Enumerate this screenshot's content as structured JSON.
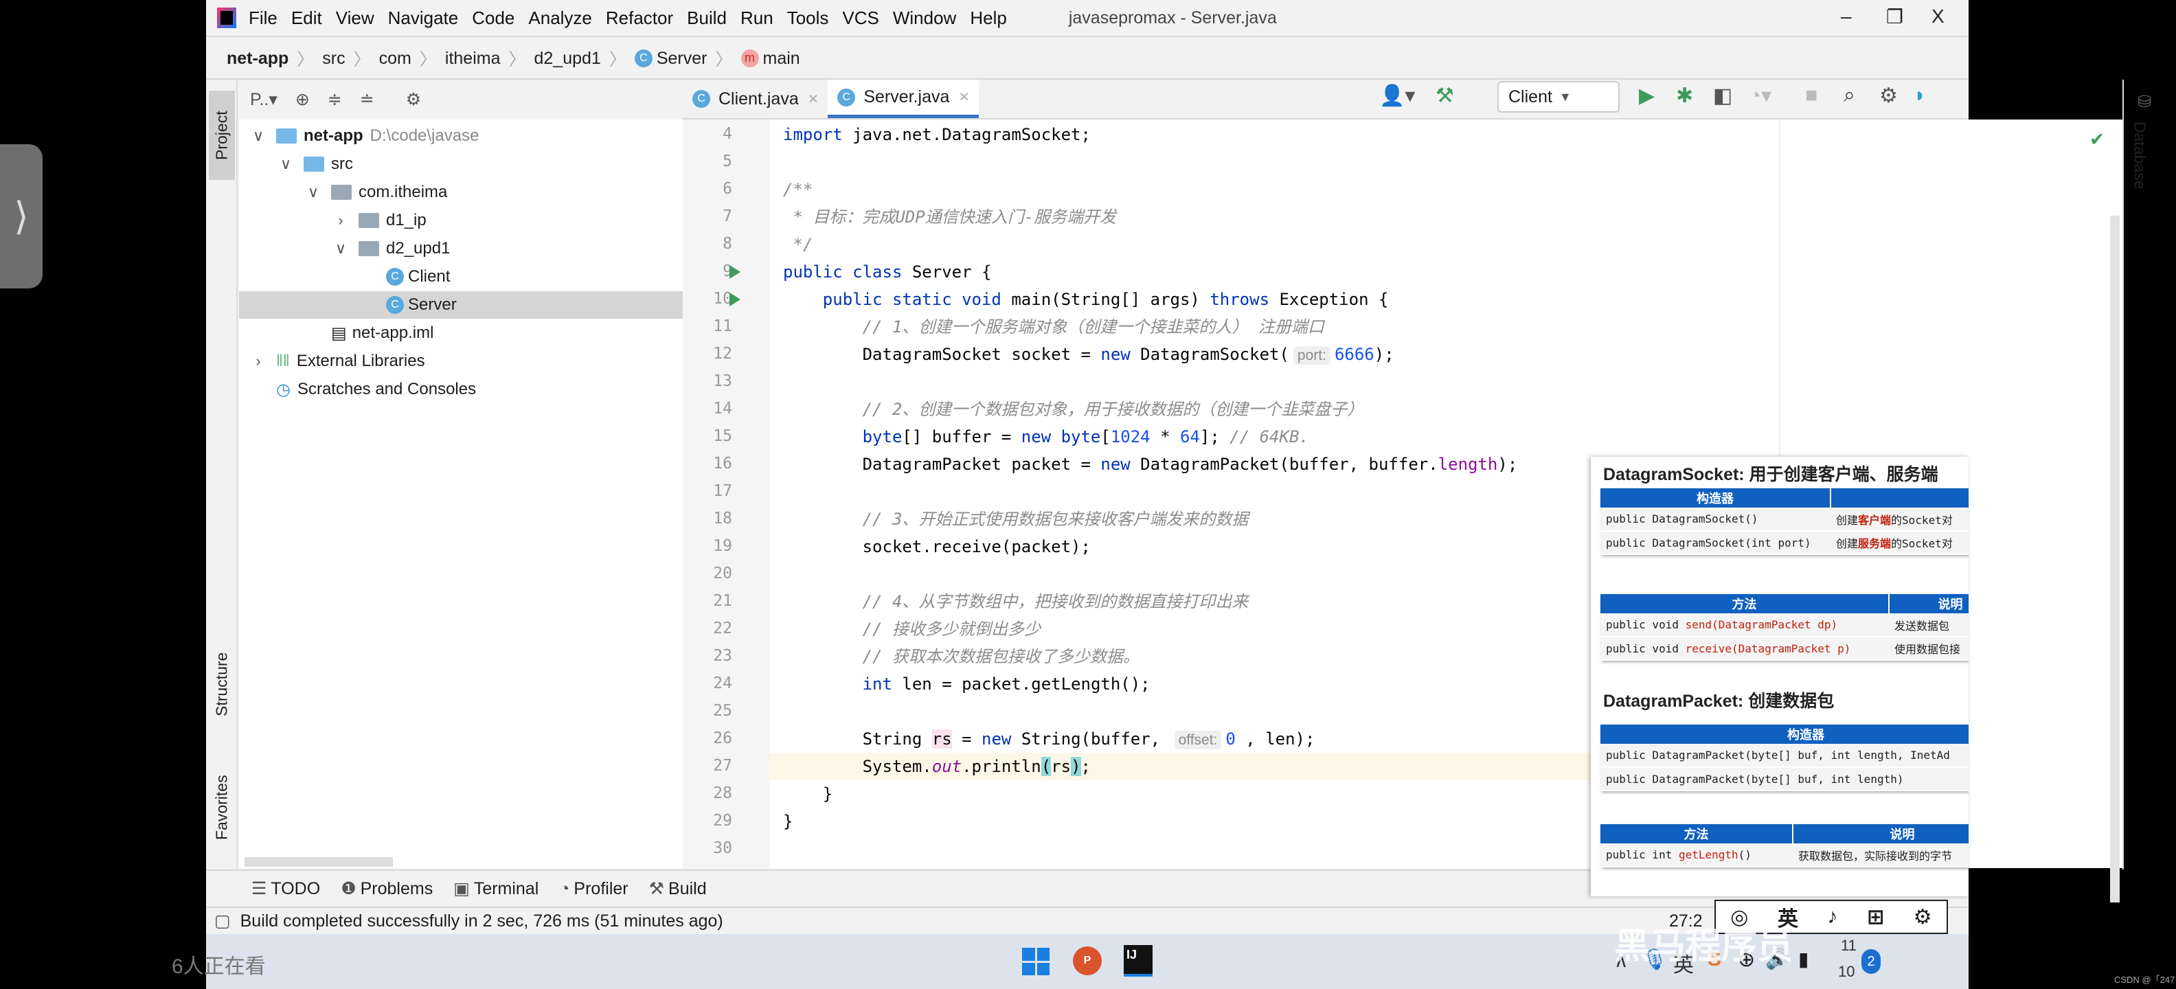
{
  "side_tab": {
    "glyph": "⟩"
  },
  "title_bar": {
    "menu": [
      "File",
      "Edit",
      "View",
      "Navigate",
      "Code",
      "Analyze",
      "Refactor",
      "Build",
      "Run",
      "Tools",
      "VCS",
      "Window",
      "Help"
    ],
    "title": "javasepromax - Server.java",
    "minimize": "–",
    "restore": "❐",
    "close": "X"
  },
  "breadcrumb": {
    "items": [
      "net-app",
      "src",
      "com",
      "itheima",
      "d2_upd1",
      "Server",
      "main"
    ]
  },
  "toolbar": {
    "run_config": "Client",
    "run_config_arrow": "▼",
    "icons": [
      "user-icon",
      "hammer-icon",
      "run-icon",
      "debug-icon",
      "coverage-icon",
      "profile-icon",
      "stop-icon",
      "search-icon",
      "gear-icon",
      "toolbox-icon"
    ]
  },
  "left_stripe": {
    "project": "Project",
    "structure": "Structure",
    "favorites": "Favorites"
  },
  "right_stripe": {
    "database": "Database"
  },
  "project_panel": {
    "view_label": "P..▾",
    "tree": [
      {
        "label": "net-app",
        "path": "D:\\code\\javase",
        "depth": 0,
        "arrow": "∨",
        "icon": "module",
        "bold": true
      },
      {
        "label": "src",
        "depth": 1,
        "arrow": "∨",
        "icon": "src-folder"
      },
      {
        "label": "com.itheima",
        "depth": 2,
        "arrow": "∨",
        "icon": "package"
      },
      {
        "label": "d1_ip",
        "depth": 3,
        "arrow": "›",
        "icon": "package"
      },
      {
        "label": "d2_upd1",
        "depth": 3,
        "arrow": "∨",
        "icon": "package"
      },
      {
        "label": "Client",
        "depth": 4,
        "arrow": "",
        "icon": "class"
      },
      {
        "label": "Server",
        "depth": 4,
        "arrow": "",
        "icon": "class",
        "selected": true
      },
      {
        "label": "net-app.iml",
        "depth": 2,
        "arrow": "",
        "icon": "file"
      },
      {
        "label": "External Libraries",
        "depth": 0,
        "arrow": "›",
        "icon": "library"
      },
      {
        "label": "Scratches and Consoles",
        "depth": 0,
        "arrow": "",
        "icon": "scratch"
      }
    ]
  },
  "tabs": [
    {
      "label": "Client.java",
      "active": false
    },
    {
      "label": "Server.java",
      "active": true
    }
  ],
  "editor": {
    "current_line": 27,
    "run_lines": [
      9,
      10
    ],
    "lines": [
      {
        "n": 4,
        "tokens": [
          [
            "import",
            "kw"
          ],
          " java.net.DatagramSocket;"
        ]
      },
      {
        "n": 5,
        "tokens": []
      },
      {
        "n": 6,
        "tokens": [
          [
            "/**",
            "cm"
          ]
        ]
      },
      {
        "n": 7,
        "tokens": [
          [
            " * 目标：完成UDP通信快速入门-服务端开发",
            "cm"
          ]
        ]
      },
      {
        "n": 8,
        "tokens": [
          [
            " */",
            "cm"
          ]
        ]
      },
      {
        "n": 9,
        "tokens": [
          [
            "public class",
            "kw"
          ],
          " Server {"
        ]
      },
      {
        "n": 10,
        "tokens": [
          "    ",
          [
            "public static void",
            "kw"
          ],
          " main(String[] args) ",
          [
            "throws",
            "kw"
          ],
          " Exception {"
        ]
      },
      {
        "n": 11,
        "tokens": [
          "        ",
          [
            "// 1、创建一个服务端对象（创建一个接韭菜的人） 注册端口",
            "cm"
          ]
        ]
      },
      {
        "n": 12,
        "tokens": [
          "        DatagramSocket socket = ",
          [
            "new",
            "kw"
          ],
          " DatagramSocket(",
          [
            "port:",
            "hint"
          ],
          [
            "6666",
            "num"
          ],
          ");"
        ]
      },
      {
        "n": 13,
        "tokens": []
      },
      {
        "n": 14,
        "tokens": [
          "        ",
          [
            "// 2、创建一个数据包对象，用于接收数据的（创建一个韭菜盘子）",
            "cm"
          ]
        ]
      },
      {
        "n": 15,
        "tokens": [
          "        ",
          [
            "byte",
            "kw"
          ],
          "[] buffer = ",
          [
            "new byte",
            "kw"
          ],
          "[",
          [
            "1024",
            "num"
          ],
          " * ",
          [
            "64",
            "num"
          ],
          "]; ",
          [
            "// 64KB.",
            "cm"
          ]
        ]
      },
      {
        "n": 16,
        "tokens": [
          "        DatagramPacket packet = ",
          [
            "new",
            "kw"
          ],
          " DatagramPacket(buffer, buffer.",
          [
            "length",
            "fld"
          ],
          ");"
        ]
      },
      {
        "n": 17,
        "tokens": []
      },
      {
        "n": 18,
        "tokens": [
          "        ",
          [
            "// 3、开始正式使用数据包来接收客户端发来的数据",
            "cm"
          ]
        ]
      },
      {
        "n": 19,
        "tokens": [
          "        socket.receive(packet);"
        ]
      },
      {
        "n": 20,
        "tokens": []
      },
      {
        "n": 21,
        "tokens": [
          "        ",
          [
            "// 4、从字节数组中，把接收到的数据直接打印出来",
            "cm"
          ]
        ]
      },
      {
        "n": 22,
        "tokens": [
          "        ",
          [
            "// 接收多少就倒出多少",
            "cm"
          ]
        ]
      },
      {
        "n": 23,
        "tokens": [
          "        ",
          [
            "// 获取本次数据包接收了多少数据。",
            "cm"
          ]
        ]
      },
      {
        "n": 24,
        "tokens": [
          "        ",
          [
            "int",
            "kw"
          ],
          " len = packet.getLength();"
        ]
      },
      {
        "n": 25,
        "tokens": []
      },
      {
        "n": 26,
        "tokens": [
          "        String ",
          [
            "rs",
            "hl"
          ],
          " = ",
          [
            "new",
            "kw"
          ],
          " String(buffer, ",
          [
            "offset:",
            "hint"
          ],
          [
            "0",
            "num"
          ],
          " , len);"
        ]
      },
      {
        "n": 27,
        "tokens": [
          "        System.",
          [
            "out",
            "sfld"
          ],
          ".println",
          [
            "(",
            "brace"
          ],
          "rs",
          [
            ")",
            "brace"
          ],
          ";"
        ]
      },
      {
        "n": 28,
        "tokens": [
          "    }"
        ]
      },
      {
        "n": 29,
        "tokens": [
          "}"
        ]
      },
      {
        "n": 30,
        "tokens": []
      }
    ]
  },
  "bottom_tools": [
    {
      "icon": "list-icon",
      "glyph": "☰",
      "label": "TODO"
    },
    {
      "icon": "problems-icon",
      "glyph": "❶",
      "label": "Problems"
    },
    {
      "icon": "terminal-icon",
      "glyph": "▣",
      "label": "Terminal"
    },
    {
      "icon": "profiler-icon",
      "glyph": "◔",
      "label": "Profiler"
    },
    {
      "icon": "hammer-icon",
      "glyph": "⚒",
      "label": "Build"
    }
  ],
  "status": {
    "message": "Build completed successfully in 2 sec, 726 ms (51 minutes ago)",
    "position": "27:2"
  },
  "overlay": {
    "title1": "DatagramSocket: 用于创建客户端、服务端",
    "table1": {
      "headers": [
        "构造器",
        ""
      ],
      "rows": [
        [
          "public DatagramSocket()",
          "创建",
          "客户端",
          "的Socket对"
        ],
        [
          "public DatagramSocket(int port)",
          "创建",
          "服务端",
          "的Socket对"
        ]
      ]
    },
    "table2": {
      "headers": [
        "方法",
        "说明"
      ],
      "rows": [
        [
          "public void ",
          "send(DatagramPacket dp)",
          "发送数据包"
        ],
        [
          "public void ",
          "receive(DatagramPacket p)",
          "使用数据包接"
        ]
      ]
    },
    "title2": "DatagramPacket: 创建数据包",
    "table3": {
      "headers": [
        "构造器"
      ],
      "rows": [
        "public DatagramPacket(byte[] buf, int length, InetAd",
        "public DatagramPacket(byte[] buf, int length)"
      ]
    },
    "table4": {
      "headers": [
        "方法",
        "说明"
      ],
      "rows": [
        [
          "public int ",
          "getLength",
          "()",
          "获取数据包，实际接收到的字节"
        ]
      ]
    }
  },
  "ime_bar": {
    "items": [
      "英",
      "♪",
      "⊞",
      "⚙"
    ]
  },
  "taskbar": {
    "viewers": "6人正在看",
    "tray_lang": "英",
    "clock_top": "11",
    "clock_bottom": "10",
    "notif": "2",
    "watermark": "黑马程序员",
    "credit": "CSDN @「247"
  }
}
